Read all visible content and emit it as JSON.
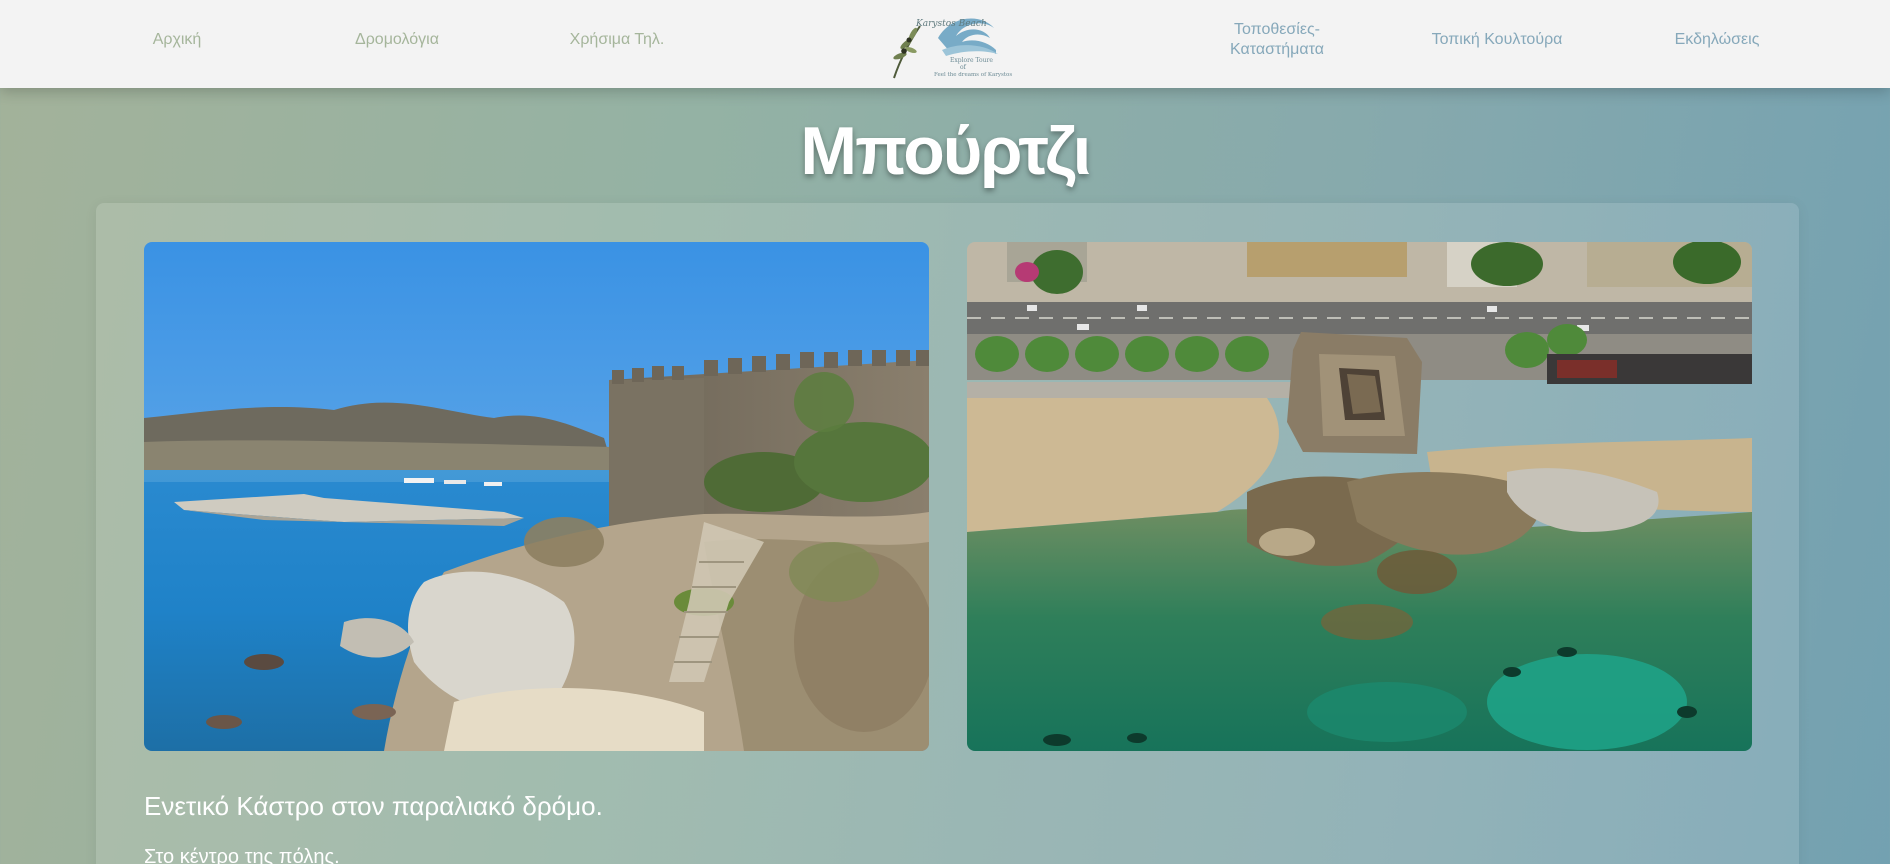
{
  "nav": {
    "left": [
      {
        "label": "Αρχική"
      },
      {
        "label": "Δρομολόγια"
      },
      {
        "label": "Χρήσιμα Τηλ."
      }
    ],
    "right": [
      {
        "label": "Τοποθεσίες-\nΚαταστήματα"
      },
      {
        "label": "Τοπική Κουλτούρα"
      },
      {
        "label": "Εκδηλώσεις"
      }
    ],
    "logo": {
      "script_text": "Karystos Beach",
      "line1": "Explore Toure",
      "line2": "of",
      "line3": "Feel the dreams of Karystos"
    }
  },
  "page": {
    "title": "Μπούρτζι",
    "caption": "Ενετικό Κάστρο στον παραλιακό δρόμο.",
    "subtext": "Στο κέντρο της πόλης."
  },
  "photos": [
    {
      "subject": "castle-coast-photo"
    },
    {
      "subject": "castle-aerial-photo"
    }
  ],
  "colors": {
    "nav_bg": "#f3f3f3",
    "nav_left_text": "#a5b59b",
    "nav_right_text": "#86a8ba",
    "title": "#ffffff"
  }
}
